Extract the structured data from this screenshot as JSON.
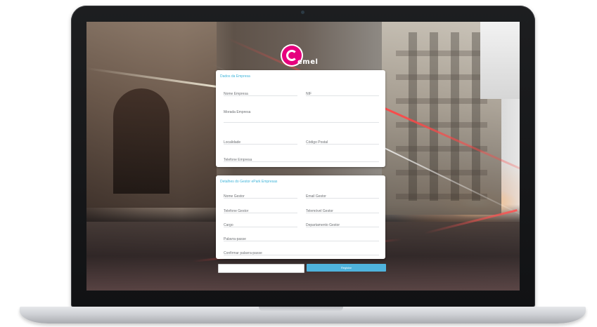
{
  "brand": {
    "logo_text": "emel",
    "accent": "#e6007e",
    "link_color": "#3fb4d9"
  },
  "company_section": {
    "title": "Dados da Empresa",
    "fields": {
      "nome_empresa": "Nome Empresa",
      "nif": "NIF",
      "morada_empresa": "Morada Empresa",
      "localidade": "Localidade",
      "codigo_postal": "Código Postal",
      "telefone_empresa": "Telefone Empresa"
    }
  },
  "manager_section": {
    "title": "Detalhes do Gestor ePark Empresas",
    "fields": {
      "nome_gestor": "Nome Gestor",
      "email_gestor": "Email Gestor",
      "telefone_gestor": "Telefone Gestor",
      "telemovel_gestor": "Telemóvel Gestor",
      "cargo": "Cargo",
      "departamento_gestor": "Departamento Gestor",
      "palavra_passe": "Palavra-passe",
      "confirmar_palavra_passe": "Confirmar palavra-passe"
    }
  },
  "actions": {
    "submit_label": "Registar",
    "submit_color": "#4fb3dd"
  }
}
